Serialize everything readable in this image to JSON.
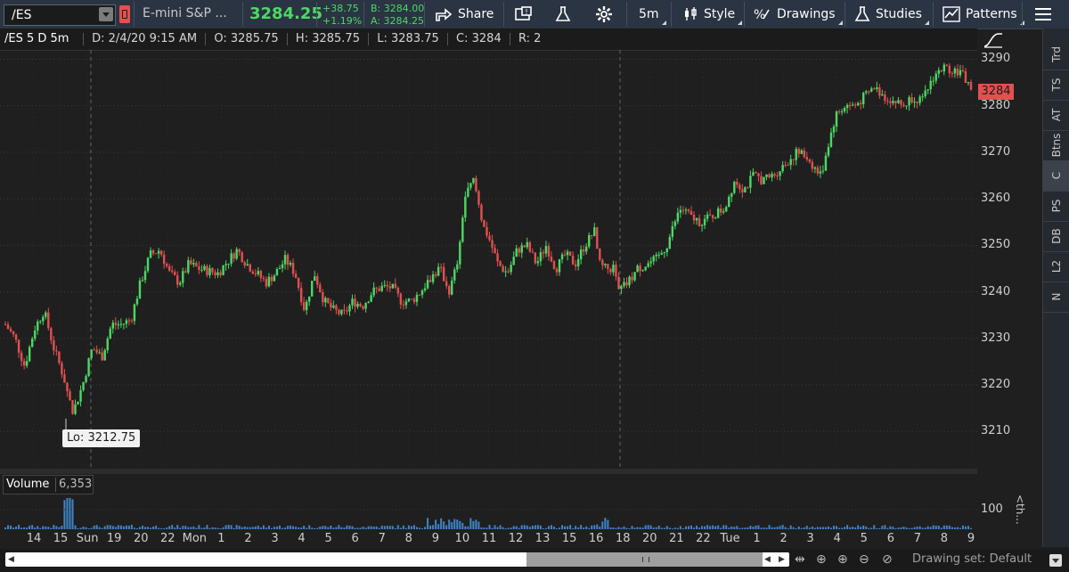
{
  "toolbar": {
    "symbol": "/ES",
    "instrument_name": "E-mini S&P ...",
    "last_price": "3284.25",
    "change_abs": "+38.75",
    "change_pct": "+1.19%",
    "bid": "B: 3284.00",
    "ask": "A: 3284.25",
    "share_label": "Share",
    "timeframe_label": "5m",
    "style_label": "Style",
    "drawings_label": "Drawings",
    "studies_label": "Studies",
    "patterns_label": "Patterns",
    "colors": {
      "up": "#4cd964",
      "down": "#e2504f",
      "toolbar_bg": "#2a3442"
    }
  },
  "header": {
    "study_name": "/ES 5 D 5m",
    "date": "D: 2/4/20 9:15 AM",
    "open": "O: 3285.75",
    "high": "H: 3285.75",
    "low": "L: 3283.75",
    "close": "C: 3284",
    "range": "R: 2"
  },
  "sidebar": {
    "tabs": [
      "Trd",
      "TS",
      "AT",
      "Btns",
      "C",
      "PS",
      "DB",
      "L2",
      "N"
    ],
    "active": "C"
  },
  "chart_data": {
    "type": "candlestick",
    "symbol": "/ES",
    "aggregation": "5m",
    "ylim": [
      3202,
      3292
    ],
    "yticks": [
      "3290",
      "3280",
      "3270",
      "3260",
      "3250",
      "3240",
      "3230",
      "3220",
      "3210"
    ],
    "last_price_tag": "3284",
    "low_annotation": "Lo: 3212.75",
    "low_value": 3212.75,
    "xticks": [
      "14",
      "15",
      "Sun",
      "19",
      "20",
      "22",
      "Mon",
      "1",
      "2",
      "3",
      "4",
      "5",
      "6",
      "7",
      "8",
      "9",
      "10",
      "11",
      "12",
      "13",
      "15",
      "16",
      "18",
      "20",
      "21",
      "22",
      "Tue",
      "1",
      "2",
      "3",
      "4",
      "5",
      "6",
      "7",
      "8",
      "9"
    ],
    "path": [
      [
        0,
        3233
      ],
      [
        0.01,
        3230
      ],
      [
        0.02,
        3224
      ],
      [
        0.03,
        3232
      ],
      [
        0.04,
        3236
      ],
      [
        0.05,
        3228
      ],
      [
        0.06,
        3222
      ],
      [
        0.07,
        3214
      ],
      [
        0.08,
        3220
      ],
      [
        0.09,
        3228
      ],
      [
        0.1,
        3226
      ],
      [
        0.11,
        3233
      ],
      [
        0.12,
        3233
      ],
      [
        0.13,
        3234
      ],
      [
        0.14,
        3242
      ],
      [
        0.15,
        3248
      ],
      [
        0.16,
        3249
      ],
      [
        0.17,
        3244
      ],
      [
        0.18,
        3242
      ],
      [
        0.19,
        3246
      ],
      [
        0.2,
        3245
      ],
      [
        0.22,
        3244
      ],
      [
        0.24,
        3249
      ],
      [
        0.25,
        3246
      ],
      [
        0.26,
        3244
      ],
      [
        0.27,
        3242
      ],
      [
        0.28,
        3244
      ],
      [
        0.29,
        3247
      ],
      [
        0.3,
        3244
      ],
      [
        0.31,
        3236
      ],
      [
        0.32,
        3244
      ],
      [
        0.33,
        3238
      ],
      [
        0.34,
        3236
      ],
      [
        0.35,
        3235
      ],
      [
        0.36,
        3238
      ],
      [
        0.37,
        3237
      ],
      [
        0.38,
        3240
      ],
      [
        0.39,
        3241
      ],
      [
        0.4,
        3241
      ],
      [
        0.41,
        3238
      ],
      [
        0.42,
        3238
      ],
      [
        0.43,
        3240
      ],
      [
        0.44,
        3243
      ],
      [
        0.45,
        3245
      ],
      [
        0.46,
        3240
      ],
      [
        0.47,
        3248
      ],
      [
        0.475,
        3260
      ],
      [
        0.485,
        3264
      ],
      [
        0.495,
        3254
      ],
      [
        0.5,
        3252
      ],
      [
        0.51,
        3246
      ],
      [
        0.52,
        3244
      ],
      [
        0.53,
        3249
      ],
      [
        0.54,
        3250
      ],
      [
        0.55,
        3246
      ],
      [
        0.56,
        3250
      ],
      [
        0.57,
        3245
      ],
      [
        0.58,
        3248
      ],
      [
        0.59,
        3246
      ],
      [
        0.6,
        3250
      ],
      [
        0.61,
        3253
      ],
      [
        0.615,
        3246
      ],
      [
        0.62,
        3245
      ],
      [
        0.63,
        3245
      ],
      [
        0.635,
        3240
      ],
      [
        0.645,
        3242
      ],
      [
        0.655,
        3245
      ],
      [
        0.665,
        3246
      ],
      [
        0.675,
        3247
      ],
      [
        0.685,
        3250
      ],
      [
        0.695,
        3256
      ],
      [
        0.7,
        3258
      ],
      [
        0.71,
        3256
      ],
      [
        0.72,
        3255
      ],
      [
        0.73,
        3256
      ],
      [
        0.745,
        3258
      ],
      [
        0.755,
        3264
      ],
      [
        0.765,
        3262
      ],
      [
        0.775,
        3265
      ],
      [
        0.785,
        3264
      ],
      [
        0.795,
        3265
      ],
      [
        0.81,
        3268
      ],
      [
        0.82,
        3270
      ],
      [
        0.83,
        3269
      ],
      [
        0.84,
        3266
      ],
      [
        0.845,
        3265
      ],
      [
        0.85,
        3270
      ],
      [
        0.86,
        3278
      ],
      [
        0.87,
        3280
      ],
      [
        0.88,
        3280
      ],
      [
        0.89,
        3282
      ],
      [
        0.9,
        3284
      ],
      [
        0.91,
        3282
      ],
      [
        0.92,
        3281
      ],
      [
        0.93,
        3280
      ],
      [
        0.94,
        3282
      ],
      [
        0.95,
        3281
      ],
      [
        0.96,
        3286
      ],
      [
        0.97,
        3288
      ],
      [
        0.98,
        3288
      ],
      [
        0.99,
        3287
      ],
      [
        1,
        3284
      ]
    ],
    "volume": {
      "label": "Volume",
      "value": "6,353",
      "ytick": "100"
    }
  },
  "bottom": {
    "drawing_set": "Drawing set: Default"
  },
  "side_label": "<th..."
}
